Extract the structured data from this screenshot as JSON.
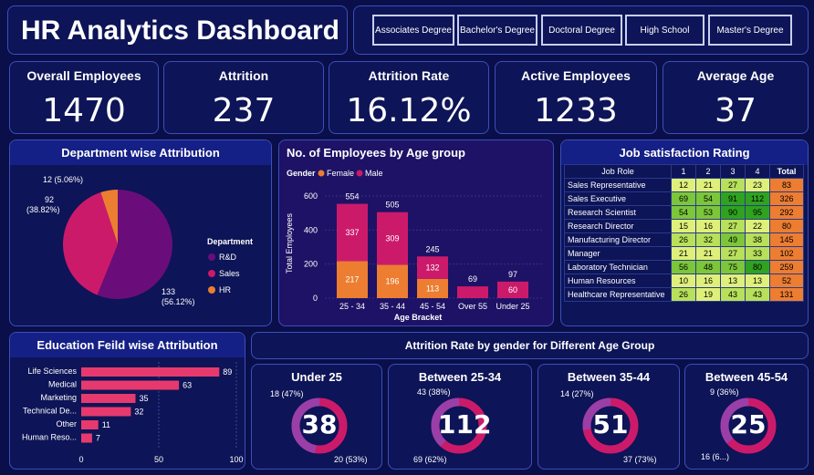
{
  "title": "HR Analytics Dashboard",
  "education_slicer": [
    "Associates Degree",
    "Bachelor's Degree",
    "Doctoral Degree",
    "High School",
    "Master's Degree"
  ],
  "kpis": [
    {
      "label": "Overall Employees",
      "value": "1470"
    },
    {
      "label": "Attrition",
      "value": "237"
    },
    {
      "label": "Attrition Rate",
      "value": "16.12%"
    },
    {
      "label": "Active Employees",
      "value": "1233"
    },
    {
      "label": "Average Age",
      "value": "37"
    }
  ],
  "colors": {
    "rd": "#6a0d7a",
    "sales": "#cc1a6b",
    "hr": "#ec7d31",
    "female": "#ec7d31",
    "male": "#cc1a6b",
    "bar": "#e63a6e"
  },
  "chart_data": [
    {
      "type": "pie",
      "title": "Department wise Attribution",
      "legend_title": "Department",
      "labels": [
        "R&D",
        "Sales",
        "HR"
      ],
      "values": [
        133,
        92,
        12
      ],
      "value_labels": [
        "133\n(56.12%)",
        "92\n(38.82%)",
        "12 (5.06%)"
      ]
    },
    {
      "type": "bar",
      "title": "No. of Employees by Age group",
      "legend_title": "Gender",
      "categories": [
        "25 - 34",
        "35 - 44",
        "45 - 54",
        "Over 55",
        "Under 25"
      ],
      "series": [
        {
          "name": "Female",
          "values": [
            217,
            196,
            113,
            0,
            0
          ]
        },
        {
          "name": "Male",
          "values": [
            337,
            309,
            132,
            0,
            60
          ]
        }
      ],
      "totals": [
        554,
        505,
        245,
        69,
        97
      ],
      "xlabel": "Age Bracket",
      "ylabel": "Total Employees",
      "ylim": [
        0,
        600
      ],
      "yticks": [
        0,
        200,
        400,
        600
      ]
    },
    {
      "type": "table",
      "title": "Job satisfaction Rating",
      "columns": [
        "Job Role",
        "1",
        "2",
        "3",
        "4",
        "Total"
      ],
      "rows": [
        [
          "Sales Representative",
          12,
          21,
          27,
          23,
          83
        ],
        [
          "Sales Executive",
          69,
          54,
          91,
          112,
          326
        ],
        [
          "Research Scientist",
          54,
          53,
          90,
          95,
          292
        ],
        [
          "Research Director",
          15,
          16,
          27,
          22,
          80
        ],
        [
          "Manufacturing Director",
          26,
          32,
          49,
          38,
          145
        ],
        [
          "Manager",
          21,
          21,
          27,
          33,
          102
        ],
        [
          "Laboratory Technician",
          56,
          48,
          75,
          80,
          259
        ],
        [
          "Human Resources",
          10,
          16,
          13,
          13,
          52
        ],
        [
          "Healthcare Representative",
          26,
          19,
          43,
          43,
          131
        ]
      ]
    },
    {
      "type": "bar",
      "orientation": "horizontal",
      "title": "Education Feild wise Attribution",
      "categories": [
        "Life Sciences",
        "Medical",
        "Marketing",
        "Technical De...",
        "Other",
        "Human Reso..."
      ],
      "values": [
        89,
        63,
        35,
        32,
        11,
        7
      ],
      "xlim": [
        0,
        100
      ],
      "xticks": [
        0,
        50,
        100
      ]
    },
    {
      "type": "pie",
      "title": "Attrition Rate by gender for Different Age Group",
      "donuts": [
        {
          "title": "Under 25",
          "center": "38",
          "values": [
            18,
            20
          ],
          "labels": [
            "18 (47%)",
            "20 (53%)"
          ]
        },
        {
          "title": "Between 25-34",
          "center": "112",
          "values": [
            43,
            69
          ],
          "labels": [
            "43 (38%)",
            "69 (62%)"
          ]
        },
        {
          "title": "Between 35-44",
          "center": "51",
          "values": [
            14,
            37
          ],
          "labels": [
            "14 (27%)",
            "37 (73%)"
          ]
        },
        {
          "title": "Between 45-54",
          "center": "25",
          "values": [
            9,
            16
          ],
          "labels": [
            "9 (36%)",
            "16 (6...)"
          ]
        }
      ]
    }
  ]
}
